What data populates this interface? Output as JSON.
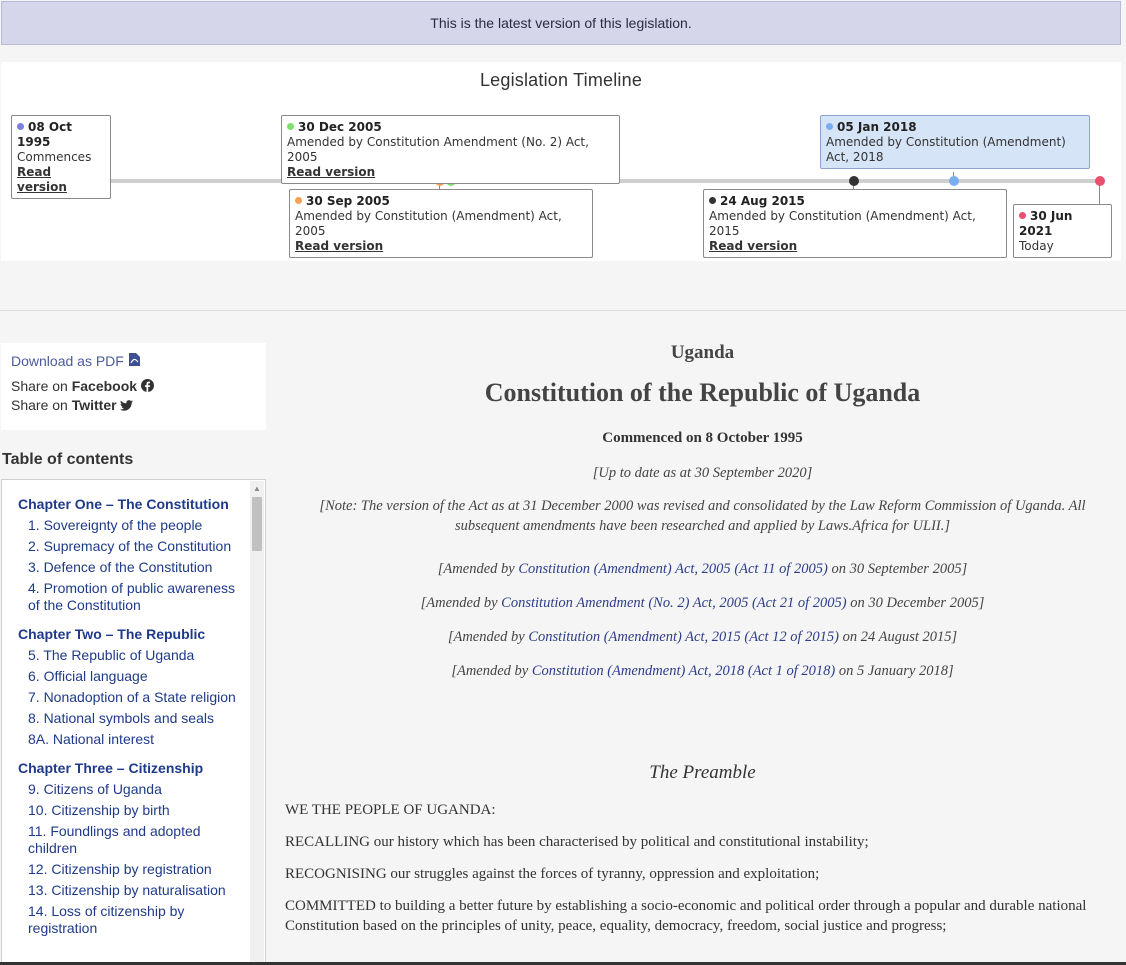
{
  "banner": {
    "text": "This is the latest version of this legislation."
  },
  "timeline": {
    "title": "Legislation Timeline",
    "events": [
      {
        "date": "08 Oct 1995",
        "desc": "Commences",
        "link": "Read version",
        "color": "#7b7fe0"
      },
      {
        "date": "30 Dec 2005",
        "desc": "Amended by Constitution Amendment (No. 2) Act, 2005",
        "link": "Read version",
        "color": "#7ee06a"
      },
      {
        "date": "30 Sep 2005",
        "desc": "Amended by Constitution (Amendment) Act, 2005",
        "link": "Read version",
        "color": "#f5a052"
      },
      {
        "date": "05 Jan 2018",
        "desc": "Amended by Constitution (Amendment) Act, 2018",
        "color": "#7aaef0"
      },
      {
        "date": "24 Aug 2015",
        "desc": "Amended by Constitution (Amendment) Act, 2015",
        "link": "Read version",
        "color": "#333333"
      },
      {
        "date": "30 Jun 2021",
        "desc": "Today",
        "color": "#e8506e"
      }
    ]
  },
  "sidebar": {
    "download_label": "Download as PDF",
    "share_facebook_prefix": "Share on",
    "share_facebook_name": "Facebook",
    "share_twitter_prefix": "Share on",
    "share_twitter_name": "Twitter",
    "toc_title": "Table of contents",
    "toc": [
      {
        "chapter": "Chapter One – The Constitution",
        "items": [
          "1. Sovereignty of the people",
          "2. Supremacy of the Constitution",
          "3. Defence of the Constitution",
          "4. Promotion of public awareness of the Constitution"
        ]
      },
      {
        "chapter": "Chapter Two – The Republic",
        "items": [
          "5. The Republic of Uganda",
          "6. Official language",
          "7. Nonadoption of a State religion",
          "8. National symbols and seals",
          "8A. National interest"
        ]
      },
      {
        "chapter": "Chapter Three – Citizenship",
        "items": [
          "9. Citizens of Uganda",
          "10. Citizenship by birth",
          "11. Foundlings and adopted children",
          "12. Citizenship by registration",
          "13. Citizenship by naturalisation",
          "14. Loss of citizenship by registration"
        ]
      }
    ]
  },
  "document": {
    "country": "Uganda",
    "title": "Constitution of the Republic of Uganda",
    "commenced": "Commenced on 8 October 1995",
    "up_to_date": "[Up to date as at 30 September 2020]",
    "note": "[Note: The version of the Act as at 31 December 2000 was revised and consolidated by the Law Reform Commission of Uganda. All subsequent amendments have been researched and applied by Laws.Africa for ULII.]",
    "amendments": [
      {
        "prefix": "[Amended by",
        "act": "Constitution (Amendment) Act, 2005",
        "ref": "(Act 11 of 2005)",
        "suffix": "on 30 September 2005]"
      },
      {
        "prefix": "[Amended by",
        "act": "Constitution Amendment (No. 2) Act, 2005",
        "ref": "(Act 21 of 2005)",
        "suffix": "on 30 December 2005]"
      },
      {
        "prefix": "[Amended by",
        "act": "Constitution (Amendment) Act, 2015",
        "ref": "(Act 12 of 2015)",
        "suffix": "on 24 August 2015]"
      },
      {
        "prefix": "[Amended by",
        "act": "Constitution (Amendment) Act, 2018",
        "ref": "(Act 1 of 2018)",
        "suffix": "on 5 January 2018]"
      }
    ],
    "preamble_title": "The Preamble",
    "paragraphs": [
      "WE THE PEOPLE OF UGANDA:",
      "RECALLING our history which has been characterised by political and constitutional instability;",
      "RECOGNISING our struggles against the forces of tyranny, oppression and exploitation;",
      "COMMITTED to building a better future by establishing a socio-economic and political order through a popular and durable national Constitution based on the principles of unity, peace, equality, democracy, freedom, social justice and progress;"
    ]
  }
}
